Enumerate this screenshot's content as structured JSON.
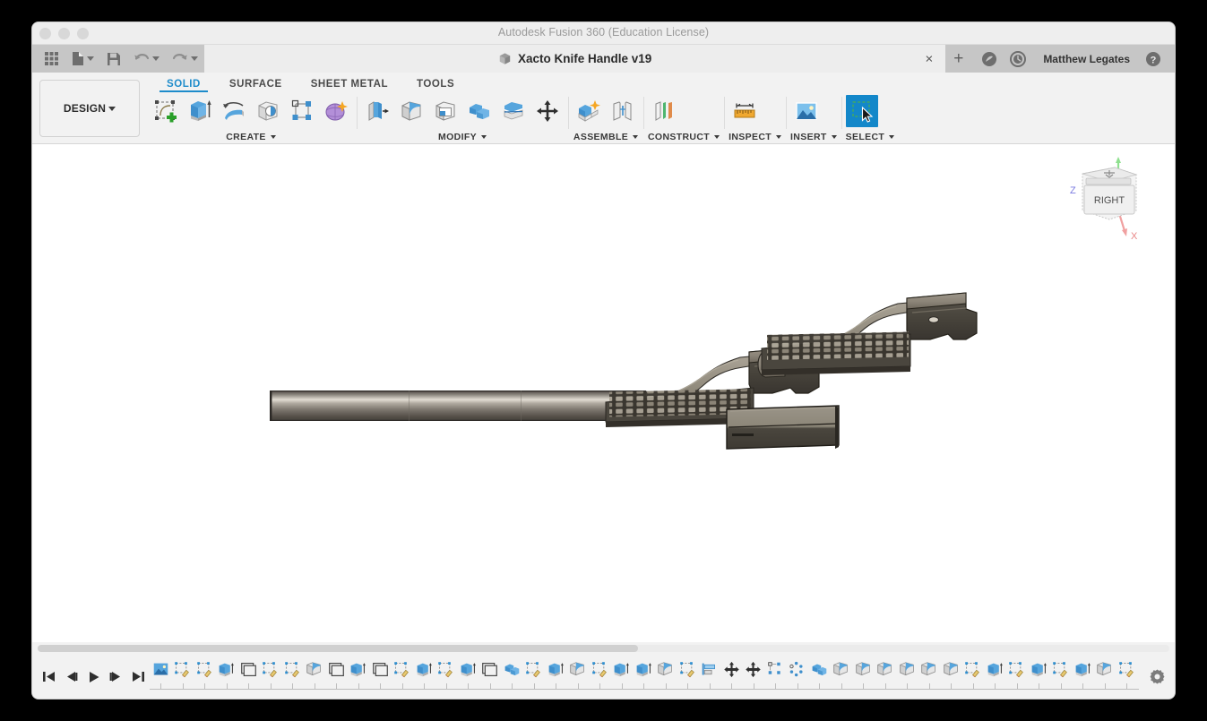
{
  "window": {
    "title": "Autodesk Fusion 360 (Education License)",
    "traffic_lights": [
      "close",
      "minimize",
      "zoom"
    ]
  },
  "tabbar": {
    "quick_access": [
      {
        "name": "app-grid-icon",
        "label": "Show Data Panel"
      },
      {
        "name": "file-icon",
        "label": "File"
      },
      {
        "name": "save-icon",
        "label": "Save"
      },
      {
        "name": "undo-icon",
        "label": "Undo"
      },
      {
        "name": "redo-icon",
        "label": "Redo"
      }
    ],
    "document_tab": {
      "label": "Xacto Knife Handle v19",
      "icon": "cube-icon",
      "close_label": "×"
    },
    "new_tab_label": "+",
    "account": {
      "user": "Matthew Legates",
      "icons": [
        "extensions-icon",
        "job-status-icon",
        "help-icon"
      ]
    }
  },
  "ribbon": {
    "design_workspace": {
      "label": "DESIGN",
      "caret": "▾"
    },
    "tabs": [
      {
        "label": "SOLID",
        "active": true
      },
      {
        "label": "SURFACE",
        "active": false
      },
      {
        "label": "SHEET METAL",
        "active": false
      },
      {
        "label": "TOOLS",
        "active": false
      }
    ],
    "groups": [
      {
        "label": "CREATE",
        "has_caret": true,
        "icons": [
          {
            "name": "create-sketch-icon",
            "label": "Create Sketch"
          },
          {
            "name": "extrude-icon",
            "label": "Extrude"
          },
          {
            "name": "revolve-icon",
            "label": "Revolve"
          },
          {
            "name": "hole-icon",
            "label": "Hole"
          },
          {
            "name": "rectangular-pattern-icon",
            "label": "Rectangular Pattern"
          },
          {
            "name": "form-icon",
            "label": "Create Form"
          }
        ]
      },
      {
        "label": "MODIFY",
        "has_caret": true,
        "icons": [
          {
            "name": "press-pull-icon",
            "label": "Press Pull"
          },
          {
            "name": "fillet-icon",
            "label": "Fillet"
          },
          {
            "name": "shell-icon",
            "label": "Shell"
          },
          {
            "name": "combine-icon",
            "label": "Combine"
          },
          {
            "name": "split-face-icon",
            "label": "Split Face"
          },
          {
            "name": "move-copy-icon",
            "label": "Move/Copy"
          }
        ]
      },
      {
        "label": "ASSEMBLE",
        "has_caret": true,
        "icons": [
          {
            "name": "new-component-icon",
            "label": "New Component"
          },
          {
            "name": "joint-icon",
            "label": "Joint"
          }
        ]
      },
      {
        "label": "CONSTRUCT",
        "has_caret": true,
        "icons": [
          {
            "name": "offset-plane-icon",
            "label": "Offset Plane"
          }
        ]
      },
      {
        "label": "INSPECT",
        "has_caret": true,
        "icons": [
          {
            "name": "measure-icon",
            "label": "Measure"
          }
        ]
      },
      {
        "label": "INSERT",
        "has_caret": true,
        "icons": [
          {
            "name": "insert-image-icon",
            "label": "Canvas"
          }
        ]
      },
      {
        "label": "SELECT",
        "has_caret": true,
        "icons": [
          {
            "name": "select-tool-icon",
            "label": "Select",
            "selected": true
          }
        ]
      }
    ]
  },
  "canvas": {
    "background": "#ffffff",
    "viewcube": {
      "face_label": "RIGHT",
      "axis_labels": [
        {
          "name": "z",
          "text": "Z",
          "color": "#7a7ae0"
        },
        {
          "name": "x",
          "text": "X",
          "color": "#e88686"
        },
        {
          "name": "y",
          "text": "",
          "color": "#86d986"
        }
      ]
    },
    "bodies": [
      {
        "name": "blade-shaft",
        "finish": "polished-steel"
      },
      {
        "name": "knife-handle-assembled",
        "finish": "dark-bronze"
      },
      {
        "name": "knife-handle-detached",
        "finish": "dark-bronze"
      },
      {
        "name": "collar-block",
        "finish": "dark-bronze"
      }
    ]
  },
  "timeline": {
    "playback": [
      {
        "name": "go-to-beginning-button",
        "glyph": "⏮"
      },
      {
        "name": "step-back-button",
        "glyph": "◀"
      },
      {
        "name": "play-button",
        "glyph": "▶"
      },
      {
        "name": "step-forward-button",
        "glyph": "▶"
      },
      {
        "name": "go-to-end-button",
        "glyph": "⏭"
      }
    ],
    "settings_label": "Timeline Settings",
    "features": [
      "canvas",
      "sketch",
      "sketch",
      "extrude",
      "shell",
      "sketch",
      "sketch",
      "fillet",
      "shell",
      "extrude",
      "shell",
      "sketch",
      "extrude",
      "sketch",
      "extrude",
      "shell",
      "combine",
      "sketch",
      "extrude",
      "fillet",
      "sketch",
      "extrude",
      "extrude",
      "fillet",
      "sketch",
      "align",
      "move",
      "move",
      "rect-pattern",
      "circ-pattern",
      "combine",
      "fillet",
      "fillet",
      "fillet",
      "fillet",
      "fillet",
      "fillet",
      "sketch",
      "extrude",
      "sketch",
      "extrude",
      "sketch",
      "extrude",
      "fillet",
      "sketch",
      "extrude",
      "fillet",
      "thread"
    ],
    "scrollbar": {
      "name": "timeline-scrollbar"
    }
  }
}
